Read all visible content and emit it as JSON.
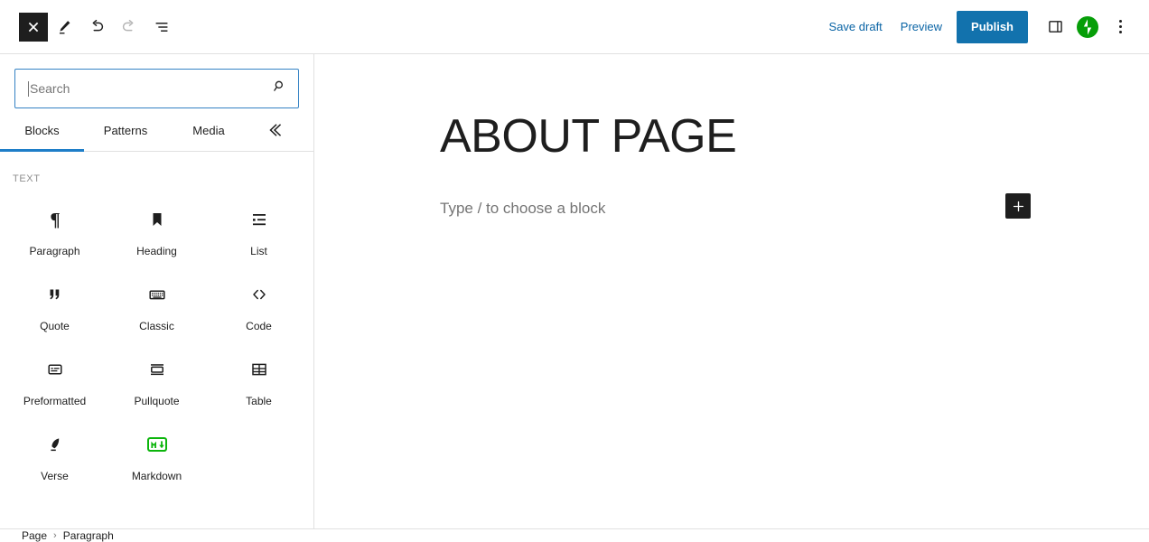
{
  "topbar": {
    "close_icon": "close-icon",
    "edit_icon": "pencil-edit-icon",
    "undo_icon": "undo-icon",
    "redo_icon": "redo-icon",
    "list_view_icon": "document-overview-icon",
    "save_draft_label": "Save draft",
    "preview_label": "Preview",
    "publish_label": "Publish",
    "settings_icon": "settings-sidebar-icon",
    "jetpack_icon": "jetpack-icon",
    "options_icon": "vertical-ellipsis-icon",
    "publish_color": "#1272ad",
    "link_color": "#0a64a5",
    "jetpack_color": "#069e08"
  },
  "inserter": {
    "search": {
      "value": "",
      "placeholder": "Search",
      "icon": "search-icon",
      "focus_color": "#3582c4"
    },
    "tabs": [
      {
        "label": "Blocks",
        "active": true
      },
      {
        "label": "Patterns",
        "active": false
      },
      {
        "label": "Media",
        "active": false
      }
    ],
    "tabs_trailing_icon": "reusable-blocks-icon",
    "active_underline_color": "#1e7ec8",
    "category_label": "TEXT",
    "blocks": [
      {
        "label": "Paragraph",
        "icon": "paragraph-icon"
      },
      {
        "label": "Heading",
        "icon": "heading-bookmark-icon"
      },
      {
        "label": "List",
        "icon": "list-icon"
      },
      {
        "label": "Quote",
        "icon": "quote-icon"
      },
      {
        "label": "Classic",
        "icon": "classic-keyboard-icon"
      },
      {
        "label": "Code",
        "icon": "code-brackets-icon"
      },
      {
        "label": "Preformatted",
        "icon": "preformatted-icon"
      },
      {
        "label": "Pullquote",
        "icon": "pullquote-icon"
      },
      {
        "label": "Table",
        "icon": "table-icon"
      },
      {
        "label": "Verse",
        "icon": "verse-quill-icon"
      },
      {
        "label": "Markdown",
        "icon": "markdown-icon"
      }
    ],
    "markdown_color": "#0cb50c"
  },
  "editor": {
    "title": "ABOUT PAGE",
    "paragraph_placeholder": "Type / to choose a block",
    "add_block_icon": "plus-icon"
  },
  "breadcrumb": {
    "items": [
      "Page",
      "Paragraph"
    ],
    "separator": "›"
  }
}
